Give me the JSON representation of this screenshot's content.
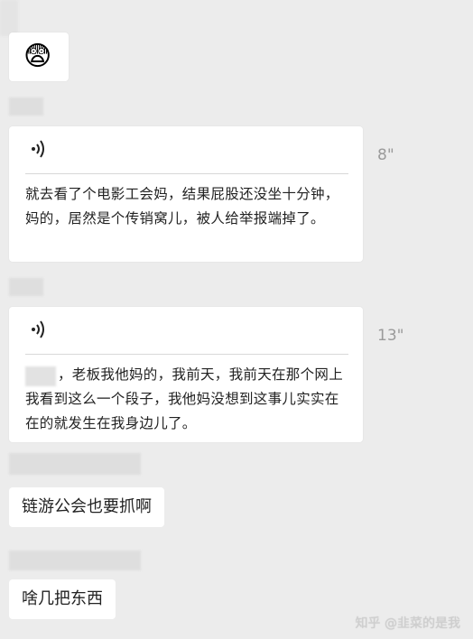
{
  "messages": [
    {
      "type": "emoji",
      "emoji": "😨"
    },
    {
      "type": "voice",
      "duration": "8\"",
      "transcript": "就去看了个电影工会妈，结果屁股还没坐十分钟，妈的，居然是个传销窝儿，被人给举报端掉了。"
    },
    {
      "type": "voice",
      "duration": "13\"",
      "transcript": "，老板我他妈的，我前天，我前天在那个网上我看到这么一个段子，我他妈没想到这事儿实实在在的就发生在我身边儿了。"
    },
    {
      "type": "text",
      "text": "链游公会也要抓啊"
    },
    {
      "type": "text",
      "text": "啥几把东西"
    }
  ],
  "watermark": "知乎 @韭菜的是我"
}
